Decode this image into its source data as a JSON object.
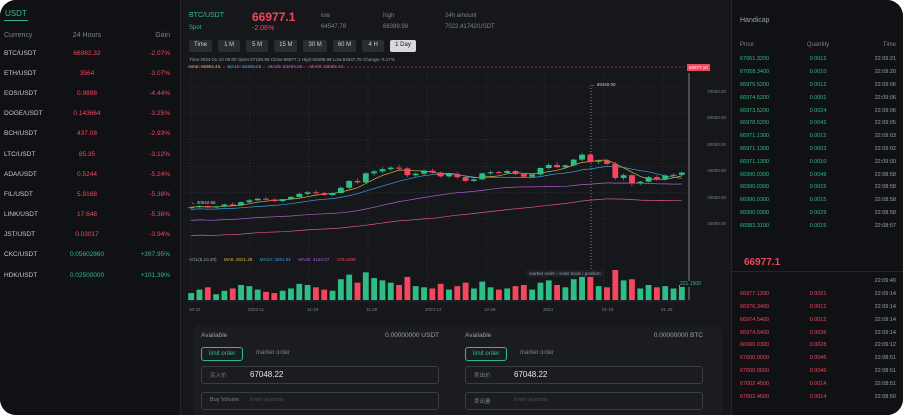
{
  "colors": {
    "up": "#2ebd85",
    "down": "#f6465d",
    "bg": "#16171b"
  },
  "left": {
    "tab": "USDT",
    "headers": [
      "Currency",
      "24 Hours",
      "Gain"
    ],
    "rows": [
      {
        "sym": "BTC/USDT",
        "price": "66982.32",
        "chg": "-2.07%",
        "dir": "neg"
      },
      {
        "sym": "ETH/USDT",
        "price": "3564",
        "chg": "-3.07%",
        "dir": "neg"
      },
      {
        "sym": "EOS/USDT",
        "price": "0.9898",
        "chg": "-4.44%",
        "dir": "neg"
      },
      {
        "sym": "DOGE/USDT",
        "price": "0.143664",
        "chg": "-3.25%",
        "dir": "neg"
      },
      {
        "sym": "BCH/USDT",
        "price": "437.08",
        "chg": "-2.93%",
        "dir": "neg"
      },
      {
        "sym": "LTC/USDT",
        "price": "85.35",
        "chg": "-3.12%",
        "dir": "neg"
      },
      {
        "sym": "ADA/USDT",
        "price": "0.5244",
        "chg": "-5.24%",
        "dir": "neg"
      },
      {
        "sym": "FIL/USDT",
        "price": "5.9168",
        "chg": "-5.38%",
        "dir": "neg"
      },
      {
        "sym": "LINK/USDT",
        "price": "17.648",
        "chg": "-5.36%",
        "dir": "neg"
      },
      {
        "sym": "JST/USDT",
        "price": "0.03017",
        "chg": "-3.94%",
        "dir": "neg"
      },
      {
        "sym": "CKC/USDT",
        "price": "0.05602860",
        "chg": "+397.95%",
        "dir": "pos"
      },
      {
        "sym": "HDK/USDT",
        "price": "0.02500000",
        "chg": "+101.39%",
        "dir": "pos"
      }
    ]
  },
  "ticker": {
    "pair": "BTC/USDT",
    "spot": "Spot",
    "price": "66977.1",
    "change": "-2.06%",
    "low_label": "low",
    "low_value": "64547.78",
    "high_label": "high",
    "high_value": "68399.98",
    "vol_label": "24h amount",
    "vol_value": "7022.41742/USDT"
  },
  "timeframes": [
    "Time",
    "1 M",
    "5 M",
    "15 M",
    "30 M",
    "60 M",
    "4 H",
    "1 Day"
  ],
  "active_timeframe": "1 Day",
  "chart_legend": {
    "ohlc": "Time:2024-01-12 00:00   Open:67180.98   Close:66977.1   High:68399.98   Low:64547.78   Change:-0.17%",
    "ma5": "MA5: 66894.45",
    "ma10": "MA10: 66309.25",
    "ma30": "MA30: 63469.28",
    "ma60": "MA60: 58065.42",
    "price_tag": "66977.10",
    "peak_label": "← 69440.00",
    "low_label": "← 30542.66",
    "vol_title": "VOL(5,10,20)",
    "vol_ma5": "MA5: 2821.28",
    "vol_ma10": "MA10: 3281.91",
    "vol_ma30": "MA30: 3154.07",
    "vol_label": "VOLUME",
    "vol_tag": "221.1500",
    "hint": "market order / order book / position"
  },
  "chart_data": {
    "type": "candlestick",
    "y_ticks": [
      "70000.00",
      "60000.00",
      "50000.00",
      "40000.00",
      "30000.00",
      "20000.00"
    ],
    "x_ticks": [
      "10-22",
      "2023-11",
      "11-19",
      "11-29",
      "2023-12",
      "12-29",
      "2024",
      "01-18",
      "01-28"
    ],
    "candles": [
      [
        34500,
        34800,
        34200,
        34700
      ],
      [
        34700,
        35200,
        34500,
        35000
      ],
      [
        35000,
        35100,
        34300,
        34600
      ],
      [
        34600,
        35000,
        34400,
        34900
      ],
      [
        34900,
        35600,
        34700,
        35400
      ],
      [
        35400,
        35900,
        35100,
        35200
      ],
      [
        35200,
        36200,
        35000,
        36000
      ],
      [
        36000,
        36800,
        35800,
        36500
      ],
      [
        36500,
        37200,
        36200,
        36900
      ],
      [
        36900,
        37400,
        36400,
        36700
      ],
      [
        36700,
        37000,
        36000,
        36300
      ],
      [
        36300,
        36900,
        36000,
        36800
      ],
      [
        36800,
        37600,
        36600,
        37400
      ],
      [
        37400,
        38500,
        37200,
        38200
      ],
      [
        38200,
        38900,
        37800,
        38600
      ],
      [
        38600,
        39200,
        38100,
        38400
      ],
      [
        38400,
        38800,
        37600,
        37900
      ],
      [
        37900,
        38600,
        37700,
        38400
      ],
      [
        38400,
        40200,
        38200,
        39800
      ],
      [
        39800,
        41800,
        39500,
        41600
      ],
      [
        41600,
        42300,
        40900,
        41200
      ],
      [
        41200,
        43900,
        41000,
        43600
      ],
      [
        43600,
        44500,
        43000,
        44100
      ],
      [
        44100,
        45200,
        43600,
        44700
      ],
      [
        44700,
        45500,
        44200,
        45100
      ],
      [
        45100,
        45900,
        44500,
        44900
      ],
      [
        44900,
        45200,
        42600,
        43100
      ],
      [
        43100,
        43800,
        42700,
        43500
      ],
      [
        43500,
        44600,
        43200,
        44300
      ],
      [
        44300,
        44800,
        43500,
        43800
      ],
      [
        43800,
        44100,
        42500,
        42800
      ],
      [
        42800,
        43700,
        42400,
        43400
      ],
      [
        43400,
        44000,
        42200,
        42600
      ],
      [
        42600,
        43000,
        41200,
        41600
      ],
      [
        41600,
        42400,
        41300,
        42000
      ],
      [
        42000,
        43800,
        41800,
        43600
      ],
      [
        43600,
        44300,
        43200,
        43900
      ],
      [
        43900,
        44200,
        43300,
        43700
      ],
      [
        43700,
        44600,
        43400,
        44200
      ],
      [
        44200,
        44500,
        43100,
        43400
      ],
      [
        43400,
        43700,
        42500,
        42700
      ],
      [
        42700,
        43600,
        42400,
        43300
      ],
      [
        43300,
        45200,
        43000,
        45000
      ],
      [
        45000,
        46200,
        44600,
        45800
      ],
      [
        45800,
        46600,
        44900,
        45200
      ],
      [
        45200,
        46000,
        44800,
        45700
      ],
      [
        45700,
        47500,
        45400,
        47200
      ],
      [
        47200,
        48900,
        46800,
        48500
      ],
      [
        48500,
        48900,
        46400,
        46800
      ],
      [
        46800,
        47300,
        46000,
        46900
      ],
      [
        46900,
        47100,
        45800,
        46100
      ],
      [
        46100,
        46600,
        41900,
        42400
      ],
      [
        42400,
        43600,
        41800,
        43100
      ],
      [
        43100,
        43500,
        40200,
        41000
      ],
      [
        41000,
        41600,
        40500,
        41400
      ],
      [
        41400,
        42900,
        41200,
        42600
      ],
      [
        42600,
        43100,
        41600,
        42000
      ],
      [
        42000,
        43300,
        41700,
        43000
      ],
      [
        43000,
        43600,
        42500,
        43200
      ],
      [
        43200,
        44000,
        42800,
        43800
      ]
    ],
    "volumes": [
      12,
      18,
      22,
      10,
      16,
      20,
      26,
      24,
      18,
      14,
      12,
      16,
      20,
      28,
      26,
      22,
      18,
      16,
      36,
      44,
      30,
      48,
      38,
      34,
      30,
      26,
      40,
      24,
      22,
      20,
      28,
      18,
      24,
      30,
      20,
      32,
      22,
      18,
      20,
      24,
      26,
      18,
      30,
      34,
      26,
      22,
      36,
      44,
      40,
      24,
      22,
      52,
      34,
      36,
      20,
      26,
      22,
      24,
      20,
      26
    ]
  },
  "form": {
    "buy": {
      "available": "Available",
      "available_value": "0.00000000 USDT",
      "limit": "limit order",
      "market": "market order",
      "price_label": "买入价",
      "price_value": "67048.22",
      "amount_label": "Buy Volume",
      "amount_placeholder": "Enter quantity"
    },
    "sell": {
      "available": "Available",
      "available_value": "0.00000000 BTC",
      "limit": "limit order",
      "market": "market order",
      "price_label": "卖出价",
      "price_value": "67048.22",
      "amount_label": "卖出量",
      "amount_placeholder": "Enter quantity"
    }
  },
  "right": {
    "title": "Handicap",
    "headers": [
      "Price",
      "Quantity",
      "Time"
    ],
    "trades": [
      {
        "price": "67061.3200",
        "qty": "0.0012",
        "time": "22:09:21"
      },
      {
        "price": "67058.3400",
        "qty": "0.0010",
        "time": "22:09:20"
      },
      {
        "price": "66975.5200",
        "qty": "0.0012",
        "time": "22:09:06"
      },
      {
        "price": "66974.5200",
        "qty": "0.0001",
        "time": "22:09:06"
      },
      {
        "price": "66973.5200",
        "qty": "0.0024",
        "time": "22:09:06"
      },
      {
        "price": "66978.5200",
        "qty": "0.0042",
        "time": "22:09:05"
      },
      {
        "price": "66971.1300",
        "qty": "0.0012",
        "time": "22:09:03"
      },
      {
        "price": "66971.1300",
        "qty": "0.0003",
        "time": "22:09:02"
      },
      {
        "price": "66971.1300",
        "qty": "0.0010",
        "time": "22:09:00"
      },
      {
        "price": "66990.0300",
        "qty": "0.0049",
        "time": "22:08:58"
      },
      {
        "price": "66990.0300",
        "qty": "0.0015",
        "time": "22:08:58"
      },
      {
        "price": "66990.0300",
        "qty": "0.0015",
        "time": "22:08:58"
      },
      {
        "price": "66990.0300",
        "qty": "0.0029",
        "time": "22:08:58"
      },
      {
        "price": "66983.3100",
        "qty": "0.0015",
        "time": "22:08:57"
      }
    ],
    "mid_price": "66977.1",
    "asks": [
      {
        "price": "",
        "qty": "",
        "time": "22:09:40"
      },
      {
        "price": "66977.1200",
        "qty": "0.0021",
        "time": "22:09:14"
      },
      {
        "price": "66976.3400",
        "qty": "0.0012",
        "time": "22:09:14"
      },
      {
        "price": "66974.5400",
        "qty": "0.0012",
        "time": "22:09:14"
      },
      {
        "price": "66974.5400",
        "qty": "0.0036",
        "time": "22:09:14"
      },
      {
        "price": "66990.0300",
        "qty": "0.0028",
        "time": "22:09:12"
      },
      {
        "price": "67000.0000",
        "qty": "0.0046",
        "time": "22:08:51"
      },
      {
        "price": "67000.0000",
        "qty": "0.0046",
        "time": "22:08:51"
      },
      {
        "price": "67002.4500",
        "qty": "0.0014",
        "time": "22:08:51"
      },
      {
        "price": "67002.4500",
        "qty": "0.0014",
        "time": "22:08:50"
      }
    ]
  }
}
